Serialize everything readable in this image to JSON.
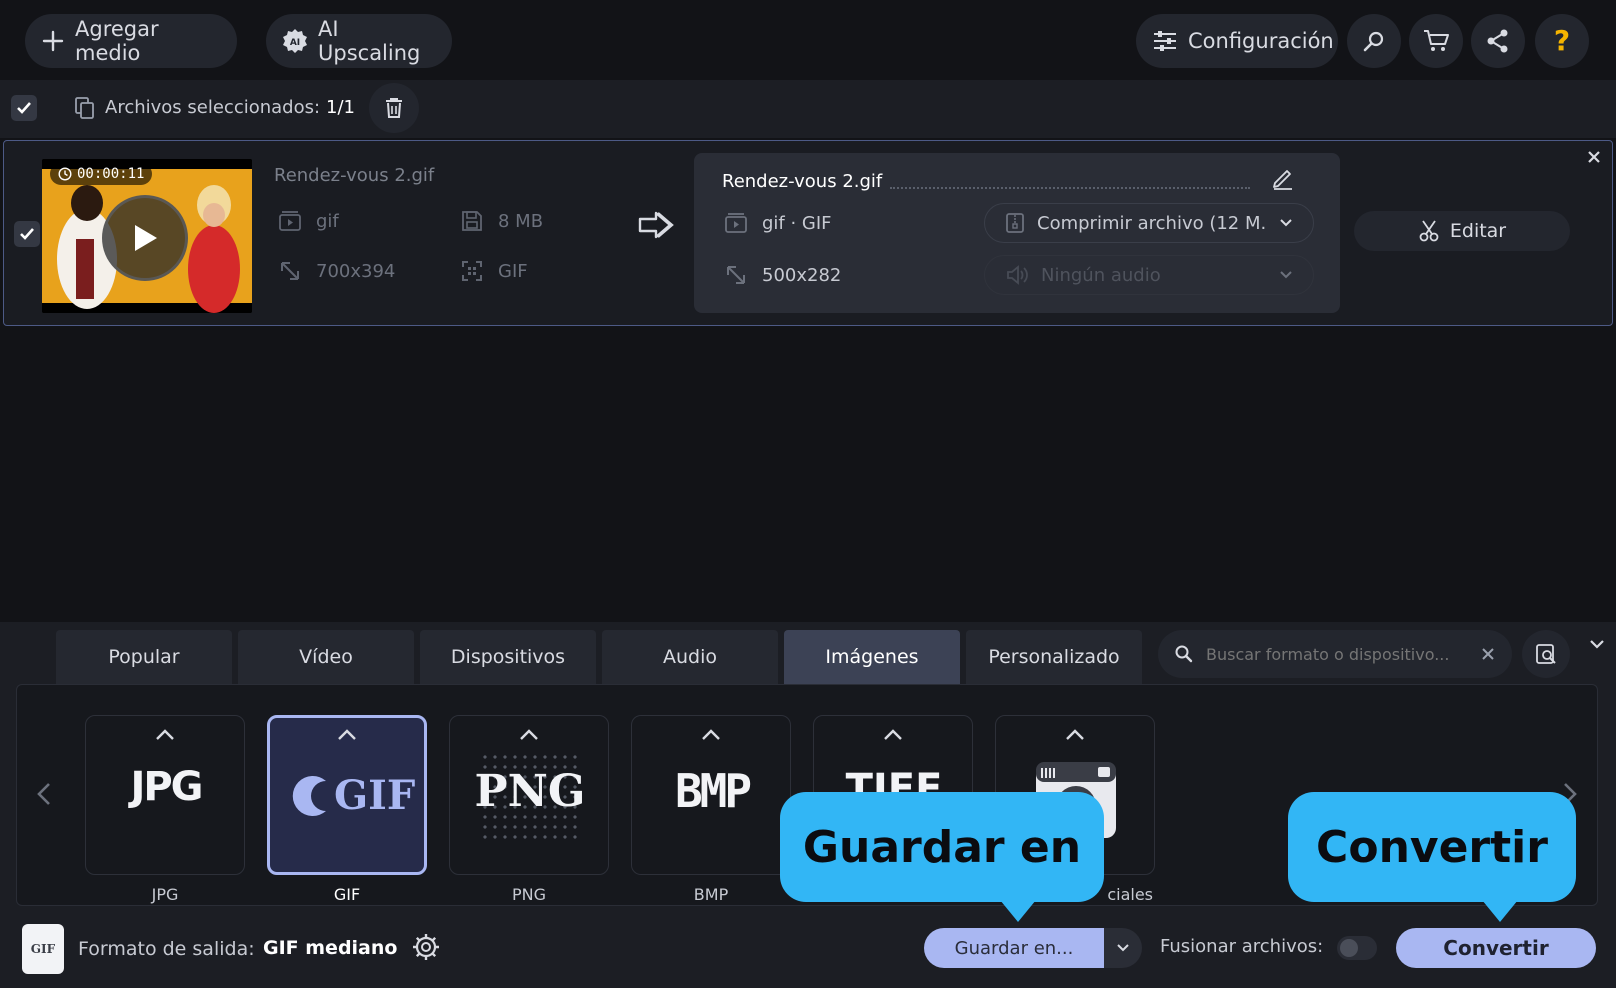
{
  "topbar": {
    "add_media": "Agregar medio",
    "ai_upscaling": "AI Upscaling",
    "settings": "Configuración"
  },
  "selection": {
    "label": "Archivos seleccionados:",
    "count": "1/1"
  },
  "file": {
    "duration": "00:00:11",
    "name": "Rendez-vous 2.gif",
    "format": "gif",
    "size": "8 MB",
    "resolution": "700x394",
    "codec": "GIF"
  },
  "output": {
    "name": "Rendez-vous 2.gif",
    "format": "gif · GIF",
    "resolution": "500x282",
    "compress": "Comprimir archivo (12 M...",
    "audio": "Ningún audio",
    "edit_label": "Editar"
  },
  "tabs": [
    {
      "label": "Popular"
    },
    {
      "label": "Vídeo"
    },
    {
      "label": "Dispositivos"
    },
    {
      "label": "Audio"
    },
    {
      "label": "Imágenes"
    },
    {
      "label": "Personalizado"
    }
  ],
  "active_tab": "Imágenes",
  "search": {
    "placeholder": "Buscar formato o dispositivo..."
  },
  "formats": [
    {
      "label": "JPG",
      "logo": "JPG"
    },
    {
      "label": "GIF",
      "logo": "GIF"
    },
    {
      "label": "PNG",
      "logo": "PNG"
    },
    {
      "label": "BMP",
      "logo": "BMP"
    },
    {
      "label": "",
      "logo": "TIFF"
    },
    {
      "label": "ciales",
      "logo": ""
    }
  ],
  "selected_format": "GIF",
  "footer": {
    "output_label": "Formato de salida:",
    "output_value": "GIF mediano",
    "save_label": "Guardar en...",
    "merge_label": "Fusionar archivos:",
    "convert_label": "Convertir"
  },
  "callouts": {
    "save": "Guardar en",
    "convert": "Convertir"
  },
  "colors": {
    "accent": "#a9b7f2",
    "callout": "#32b6f5",
    "help_icon": "#f5b400"
  }
}
